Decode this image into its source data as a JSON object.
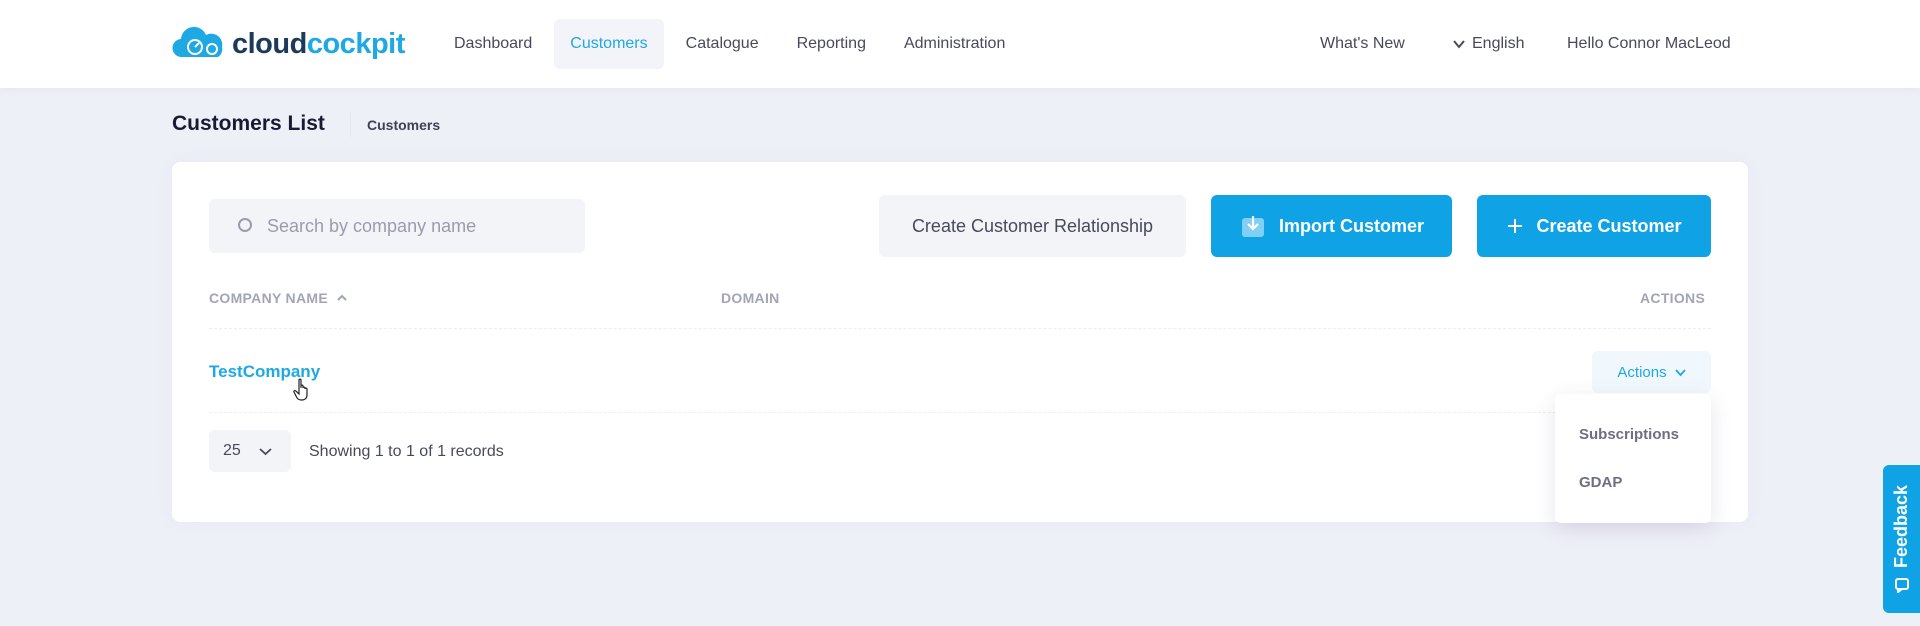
{
  "header": {
    "logo": {
      "part1": "cloud",
      "part2": "cockpit"
    },
    "nav": [
      {
        "label": "Dashboard",
        "active": false
      },
      {
        "label": "Customers",
        "active": true
      },
      {
        "label": "Catalogue",
        "active": false
      },
      {
        "label": "Reporting",
        "active": false
      },
      {
        "label": "Administration",
        "active": false
      }
    ],
    "whats_new": "What's New",
    "language": "English",
    "greeting": "Hello Connor MacLeod"
  },
  "page": {
    "title": "Customers List",
    "breadcrumb": "Customers"
  },
  "toolbar": {
    "search_placeholder": "Search by company name",
    "create_relationship": "Create Customer Relationship",
    "import_customer": "Import Customer",
    "create_customer": "Create Customer"
  },
  "table": {
    "headers": {
      "company": "COMPANY NAME",
      "domain": "DOMAIN",
      "actions": "ACTIONS"
    },
    "rows": [
      {
        "company": "TestCompany",
        "domain": "",
        "actions_label": "Actions"
      }
    ]
  },
  "pagination": {
    "page_size": "25",
    "summary": "Showing 1 to 1 of 1 records"
  },
  "actions_menu": {
    "items": [
      "Subscriptions",
      "GDAP"
    ]
  },
  "feedback": {
    "label": "Feedback"
  },
  "colors": {
    "accent": "#0fa3e6",
    "link": "#1ea8e4",
    "background": "#eef0f8"
  },
  "icons": [
    "logo-icon",
    "chevron-down-icon",
    "search-icon",
    "import-icon",
    "plus-icon",
    "sort-up-icon",
    "hand-cursor-icon",
    "feedback-icon"
  ]
}
